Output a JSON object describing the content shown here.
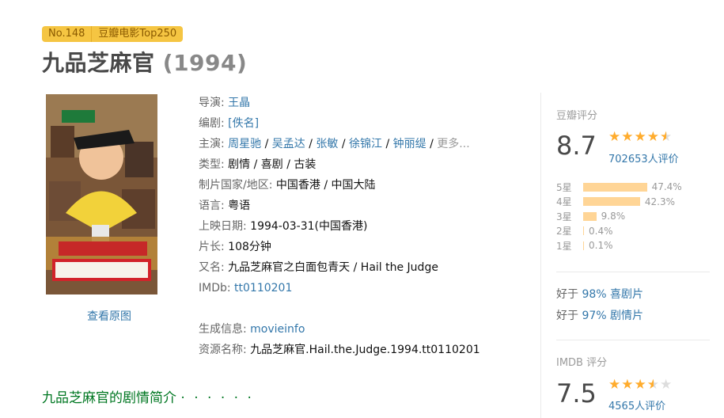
{
  "badge": {
    "rank": "No.148",
    "list": "豆瓣电影Top250"
  },
  "title": {
    "name": "九品芝麻官",
    "year": "(1994)"
  },
  "poster": {
    "link": "查看原图"
  },
  "info": {
    "director_label": "导演:",
    "director": "王晶",
    "writer_label": "编剧:",
    "writer": "[佚名]",
    "cast_label": "主演:",
    "cast": [
      "周星驰",
      "吴孟达",
      "张敏",
      "徐锦江",
      "钟丽缇"
    ],
    "cast_more": "更多...",
    "genre_label": "类型:",
    "genre": "剧情 / 喜剧 / 古装",
    "country_label": "制片国家/地区:",
    "country": "中国香港 / 中国大陆",
    "language_label": "语言:",
    "language": "粤语",
    "release_label": "上映日期:",
    "release": "1994-03-31(中国香港)",
    "runtime_label": "片长:",
    "runtime": "108分钟",
    "aka_label": "又名:",
    "aka": "九品芝麻官之白面包青天 / Hail the Judge",
    "imdb_label": "IMDb:",
    "imdb": "tt0110201",
    "gen_label": "生成信息:",
    "gen": "movieinfo",
    "res_label": "资源名称:",
    "res": "九品芝麻官.Hail.the.Judge.1994.tt0110201"
  },
  "synopsis": {
    "heading": "九品芝麻官的剧情简介",
    "dots": "· · · · · ·"
  },
  "douban": {
    "label": "豆瓣评分",
    "score": "8.7",
    "votes": "702653人评价",
    "stars": 4.5,
    "breakdown": [
      {
        "label": "5星",
        "pct": "47.4%",
        "value": 47.4
      },
      {
        "label": "4星",
        "pct": "42.3%",
        "value": 42.3
      },
      {
        "label": "3星",
        "pct": "9.8%",
        "value": 9.8
      },
      {
        "label": "2星",
        "pct": "0.4%",
        "value": 0.4
      },
      {
        "label": "1星",
        "pct": "0.1%",
        "value": 0.1
      }
    ],
    "better1_prefix": "好于",
    "better1_pct": "98%",
    "better1_genre": "喜剧片",
    "better2_prefix": "好于",
    "better2_pct": "97%",
    "better2_genre": "剧情片"
  },
  "imdb_rating": {
    "label": "IMDB 评分",
    "score": "7.5",
    "votes": "4565人评价",
    "stars": 3.5
  },
  "colors": {
    "star": "#ffac2d",
    "link": "#3377aa",
    "badge": "#f5c542",
    "synopsis": "#007722"
  }
}
